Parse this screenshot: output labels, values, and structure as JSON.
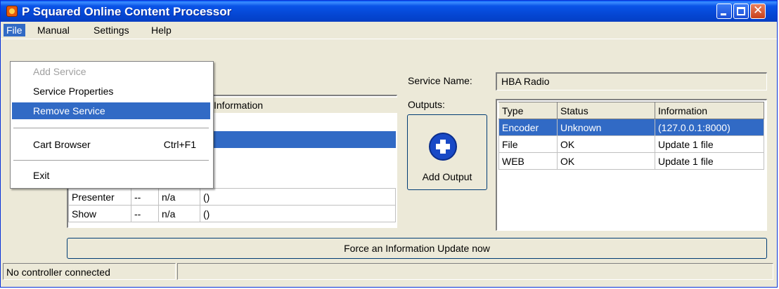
{
  "window": {
    "title": "P Squared Online Content Processor"
  },
  "menubar": {
    "items": [
      "File",
      "Manual",
      "Settings",
      "Help"
    ]
  },
  "file_menu": {
    "items": [
      {
        "label": "Add Service",
        "disabled": true
      },
      {
        "label": "Service Properties"
      },
      {
        "label": "Remove Service",
        "highlighted": true
      },
      {
        "label": "Cart Browser",
        "shortcut": "Ctrl+F1"
      },
      {
        "label": "Exit"
      }
    ]
  },
  "left_table": {
    "header_information": "Information",
    "rows": [
      {
        "c1": "Presenter",
        "c2": "--",
        "c3": "n/a",
        "c4": "()"
      },
      {
        "c1": "Show",
        "c2": "--",
        "c3": "n/a",
        "c4": "()"
      }
    ]
  },
  "service": {
    "name_label": "Service Name:",
    "name_value": "HBA Radio"
  },
  "outputs": {
    "label": "Outputs:",
    "add_button": "Add Output",
    "columns": [
      "Type",
      "Status",
      "Information"
    ],
    "rows": [
      {
        "type": "Encoder",
        "status": "Unknown",
        "info": "(127.0.0.1:8000)"
      },
      {
        "type": "File",
        "status": "OK",
        "info": "Update 1 file"
      },
      {
        "type": "WEB",
        "status": "OK",
        "info": "Update 1 file"
      }
    ]
  },
  "update_button": "Force an Information Update now",
  "status": {
    "text": "No controller connected"
  },
  "colors": {
    "titlebar": "#0548d6",
    "selection": "#316ac5",
    "face": "#ece9d8"
  },
  "icons": [
    "app-icon",
    "minimize-icon",
    "maximize-icon",
    "close-icon",
    "add-output-plus-icon"
  ]
}
